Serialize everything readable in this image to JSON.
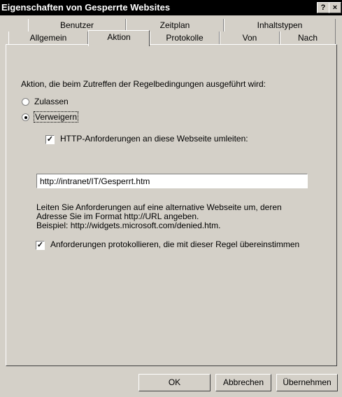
{
  "window": {
    "title": "Eigenschaften von Gesperrte Websites",
    "help_label": "?",
    "close_label": "×"
  },
  "tabs": {
    "row1": [
      "Benutzer",
      "Zeitplan",
      "Inhaltstypen"
    ],
    "row2": [
      "Allgemein",
      "Aktion",
      "Protokolle",
      "Von",
      "Nach"
    ],
    "active": "Aktion"
  },
  "action": {
    "prompt": "Aktion, die beim Zutreffen der Regelbedingungen ausgeführt wird:",
    "allow_label": "Zulassen",
    "deny_label": "Verweigern",
    "selected": "Verweigern"
  },
  "redirect": {
    "checkbox_label": "HTTP-Anforderungen an diese Webseite umleiten:",
    "checked": true,
    "url_value": "http://intranet/IT/Gesperrt.htm",
    "help_line1": "Leiten Sie Anforderungen auf eine alternative Webseite um, deren",
    "help_line2": "Adresse Sie im Format http://URL angeben.",
    "help_line3": "Beispiel: http://widgets.microsoft.com/denied.htm."
  },
  "log": {
    "checkbox_label": "Anforderungen protokollieren, die mit dieser Regel übereinstimmen",
    "checked": true
  },
  "buttons": {
    "ok": "OK",
    "cancel": "Abbrechen",
    "apply": "Übernehmen"
  }
}
